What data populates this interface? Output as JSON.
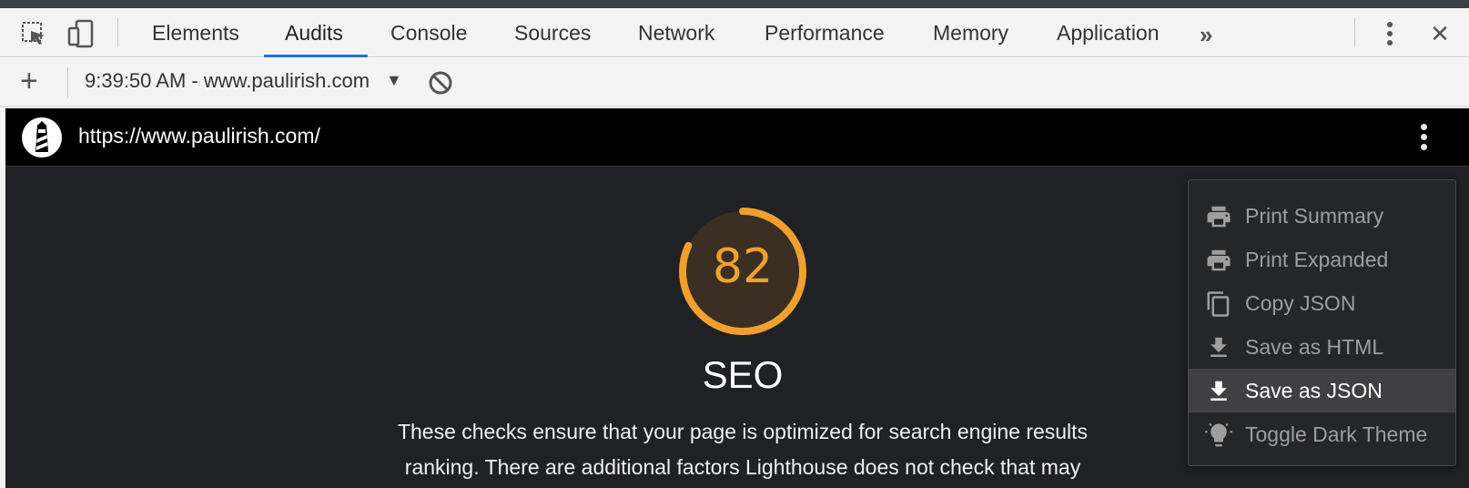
{
  "devtools": {
    "tabs": [
      {
        "label": "Elements"
      },
      {
        "label": "Audits"
      },
      {
        "label": "Console"
      },
      {
        "label": "Sources"
      },
      {
        "label": "Network"
      },
      {
        "label": "Performance"
      },
      {
        "label": "Memory"
      },
      {
        "label": "Application"
      }
    ],
    "active_tab": "Audits",
    "more_tabs_glyph": "»",
    "close_glyph": "✕"
  },
  "toolbar": {
    "add_glyph": "+",
    "report_label": "9:39:50 AM - www.paulirish.com",
    "caret_glyph": "▼"
  },
  "lighthouse": {
    "url": "https://www.paulirish.com/",
    "category": {
      "score": "82",
      "title": "SEO",
      "description": "These checks ensure that your page is optimized for search engine results ranking. There are additional factors Lighthouse does not check that may"
    },
    "score_color": "#f0a12d",
    "menu": {
      "items": [
        {
          "label": "Print Summary",
          "icon": "print-icon"
        },
        {
          "label": "Print Expanded",
          "icon": "print-icon"
        },
        {
          "label": "Copy JSON",
          "icon": "copy-icon"
        },
        {
          "label": "Save as HTML",
          "icon": "download-icon"
        },
        {
          "label": "Save as JSON",
          "icon": "download-icon"
        },
        {
          "label": "Toggle Dark Theme",
          "icon": "lightbulb-icon"
        }
      ],
      "highlighted": "Save as JSON"
    }
  }
}
